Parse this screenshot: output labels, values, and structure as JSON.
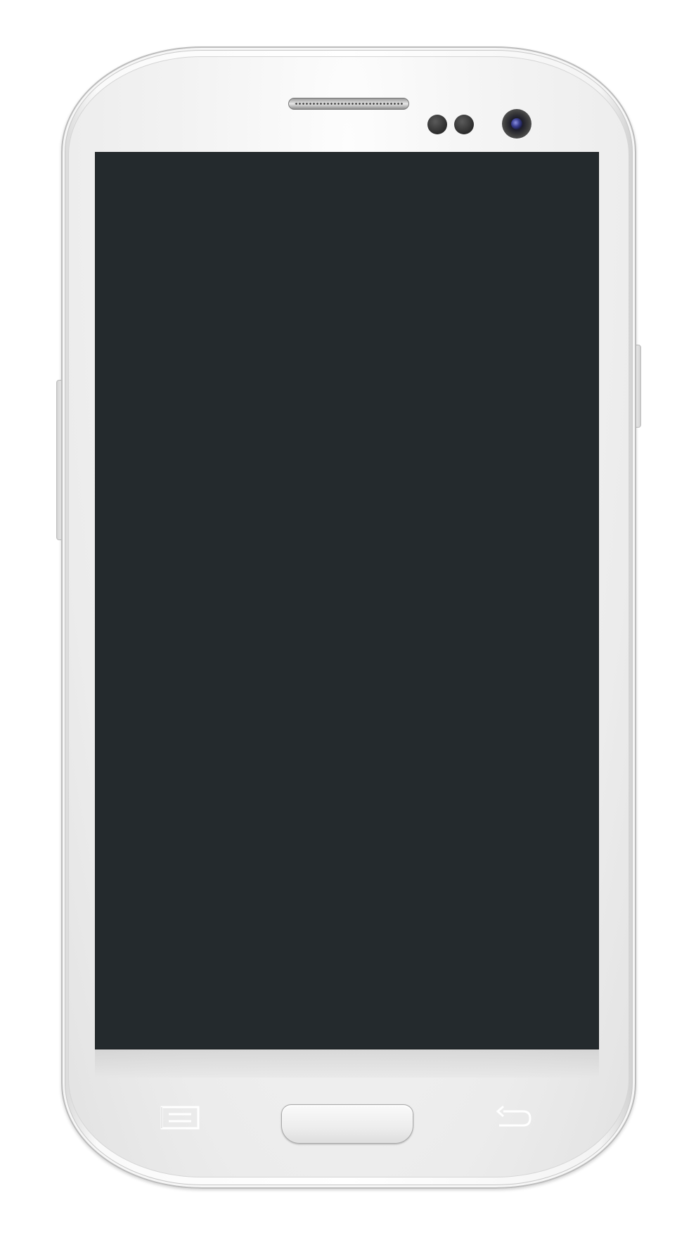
{
  "device": {
    "model": "",
    "body_color": "#f2f2f2",
    "screen_color": "#242a2d"
  },
  "screen": {
    "content": ""
  },
  "icons": {
    "menu_key": "menu-icon",
    "back_key": "back-arrow-icon",
    "home_button": "home-button",
    "front_camera": "camera-icon",
    "earpiece": "speaker-icon"
  }
}
